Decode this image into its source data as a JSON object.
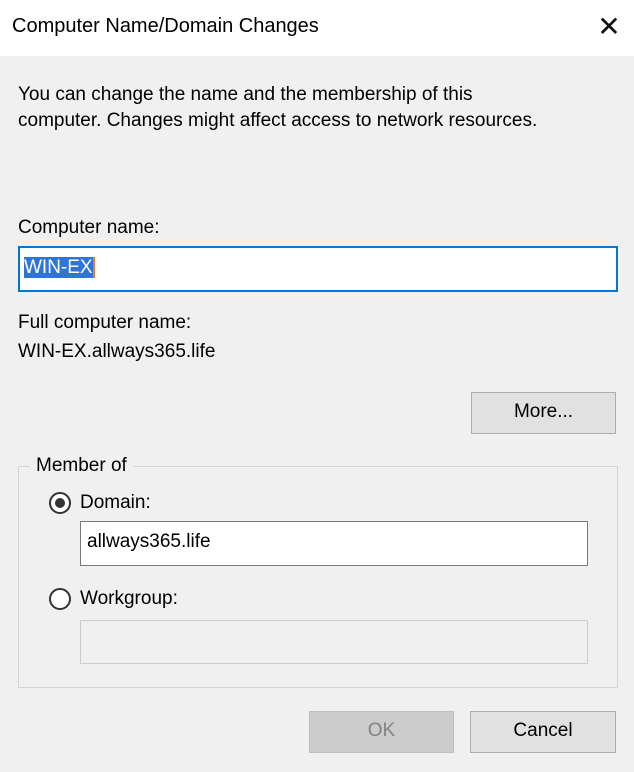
{
  "window": {
    "title": "Computer Name/Domain Changes",
    "close_icon": "close-icon"
  },
  "description": [
    "You can change the name and the membership of this",
    "computer. Changes might affect access to network resources."
  ],
  "computer_name": {
    "label": "Computer name:",
    "value": "WIN-EX"
  },
  "full_name": {
    "label": "Full computer name:",
    "value": "WIN-EX.allways365.life"
  },
  "more_label": "More...",
  "member_of": {
    "legend": "Member of",
    "domain_label": "Domain:",
    "domain_value": "allways365.life",
    "domain_selected": true,
    "workgroup_label": "Workgroup:",
    "workgroup_value": ""
  },
  "ok_label": "OK",
  "cancel_label": "Cancel",
  "colors": {
    "focus": "#0078d7",
    "selection": "#3074d7"
  }
}
